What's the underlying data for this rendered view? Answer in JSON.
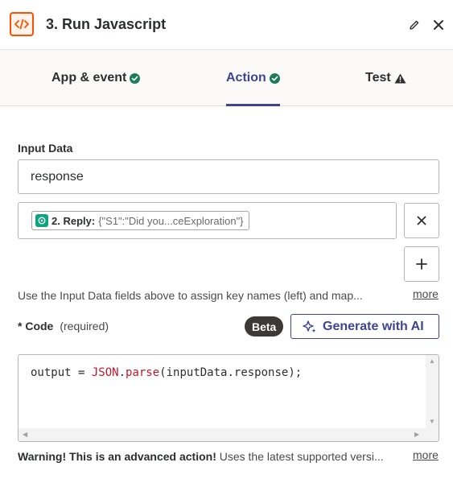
{
  "header": {
    "title": "3. Run Javascript",
    "app_icon": "code-icon",
    "accent": "#ff4f00"
  },
  "tabs": [
    {
      "label": "App & event",
      "status": "complete"
    },
    {
      "label": "Action",
      "status": "complete",
      "active": true
    },
    {
      "label": "Test",
      "status": "warning"
    }
  ],
  "input_data": {
    "label": "Input Data",
    "key_value": "response",
    "mapped_step": "2. Reply:",
    "mapped_value": "{\"S1\":\"Did you...ceExploration\"}",
    "help_text": "Use the Input Data fields above to assign key names (left) and map...",
    "more_label": "more"
  },
  "code": {
    "required_marker": "*",
    "label": "Code",
    "required_text": "(required)",
    "beta_label": "Beta",
    "generate_label": "Generate with AI",
    "line_1": {
      "t1": "output = ",
      "t2": "JSON",
      "t3": ".",
      "t4": "parse",
      "t5": "(inputData.response);"
    }
  },
  "warning": {
    "strong": "Warning! This is an advanced action!",
    "text": " Uses the latest supported versi...",
    "more_label": "more"
  },
  "colors": {
    "primary": "#3d4592",
    "success": "#1c7c56",
    "code_keyword": "#c4162a"
  }
}
